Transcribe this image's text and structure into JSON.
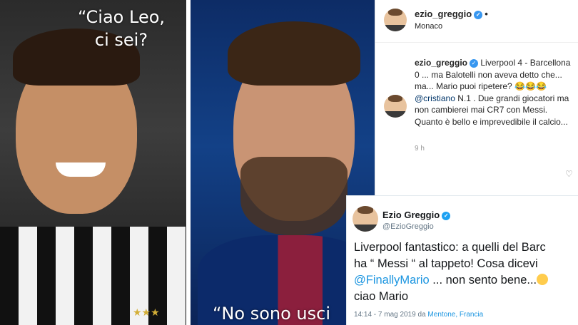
{
  "meme": {
    "left_caption_line1": "“Ciao Leo,",
    "left_caption_line2": "ci sei?",
    "right_caption": "“No sono usci"
  },
  "instagram": {
    "username": "ezio_greggio",
    "location": "Monaco",
    "comment": {
      "username": "ezio_greggio",
      "text_part1": "Liverpool 4 - Barcellona 0 ... ma Balotelli non aveva detto che... ma... Mario puoi ripetere? 😂😂😂",
      "mention": "@cristiano",
      "text_part2": "N.1 . Due grandi giocatori ma non cambierei mai CR7 con Messi. Quanto è bello e imprevedibile il calcio..."
    },
    "time": "9 h"
  },
  "tweet": {
    "display_name": "Ezio Greggio",
    "handle": "@EzioGreggio",
    "line1": "Liverpool fantastico: a quelli del Barc",
    "line2": "ha “ Messi “ al tappeto! Cosa dicevi",
    "mention": "@FinallyMario",
    "line3_rest": " ... non sento bene...",
    "line4": "ciao Mario",
    "timestamp": "14:14 - 7 mag 2019 da ",
    "place": "Mentone, Francia"
  },
  "colors": {
    "instagram_verified": "#3897f0",
    "twitter_link": "#1b95e0",
    "instagram_mention": "#003569"
  }
}
